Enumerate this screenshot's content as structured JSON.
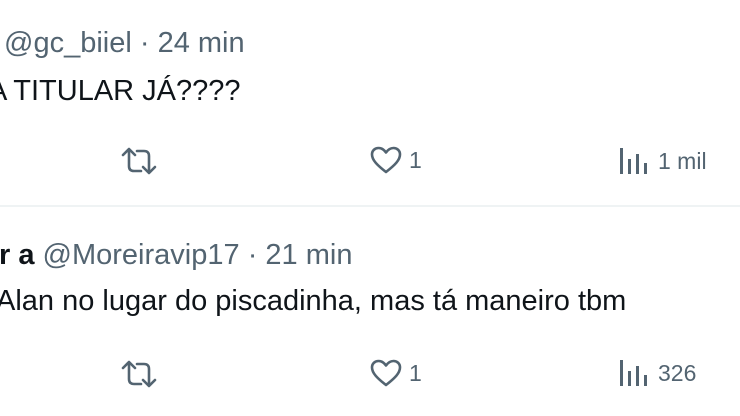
{
  "tweets": [
    {
      "name": "",
      "handle": "@gc_biiel",
      "separator": "·",
      "time": "24 min",
      "text": "A TITULAR JÁ????",
      "actions": {
        "retweet_icon": "retweet-icon",
        "like_icon": "heart-icon",
        "like_count": "1",
        "views_icon": "analytics-icon",
        "views_count": "1 mil"
      }
    },
    {
      "name": "r a",
      "handle": "@Moreiravip17",
      "separator": "·",
      "time": "21 min",
      "text": "Alan no lugar do piscadinha, mas tá maneiro tbm",
      "actions": {
        "retweet_icon": "retweet-icon",
        "like_icon": "heart-icon",
        "like_count": "1",
        "views_icon": "analytics-icon",
        "views_count": "326"
      }
    }
  ],
  "colors": {
    "text_primary": "#0f1419",
    "text_secondary": "#536471",
    "divider": "#eff3f4",
    "background": "#ffffff"
  }
}
